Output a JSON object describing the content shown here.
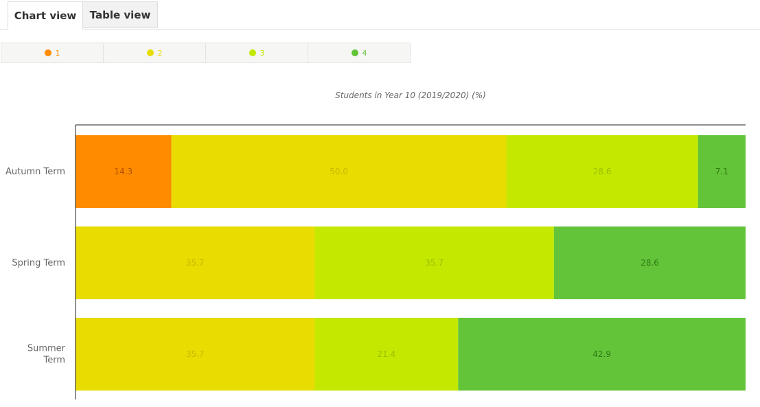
{
  "tabs": [
    {
      "label": "Chart view",
      "active": true
    },
    {
      "label": "Table view",
      "active": false
    }
  ],
  "legend": [
    {
      "label": "1",
      "color": "#ff8c00"
    },
    {
      "label": "2",
      "color": "#e8dc00"
    },
    {
      "label": "3",
      "color": "#c4e800"
    },
    {
      "label": "4",
      "color": "#63c43a"
    }
  ],
  "chart_data": {
    "type": "bar",
    "orientation": "horizontal",
    "stacked": true,
    "title": "Students in Year 10 (2019/2020) (%)",
    "categories": [
      [
        "Autumn Term"
      ],
      [
        "Spring Term"
      ],
      [
        "Summer",
        "Term"
      ]
    ],
    "series": [
      {
        "name": "1",
        "color": "#ff8c00",
        "label_color": "#b34f00",
        "values": [
          14.3,
          0,
          0
        ]
      },
      {
        "name": "2",
        "color": "#e8dc00",
        "label_color": "#c8b800",
        "values": [
          50.0,
          35.7,
          35.7
        ]
      },
      {
        "name": "3",
        "color": "#c4e800",
        "label_color": "#9cc000",
        "values": [
          28.6,
          35.7,
          21.4
        ]
      },
      {
        "name": "4",
        "color": "#63c43a",
        "label_color": "#2e7a10",
        "values": [
          7.1,
          28.6,
          42.9
        ]
      }
    ],
    "xlim": [
      0,
      100
    ],
    "legend_position": "top-left"
  }
}
